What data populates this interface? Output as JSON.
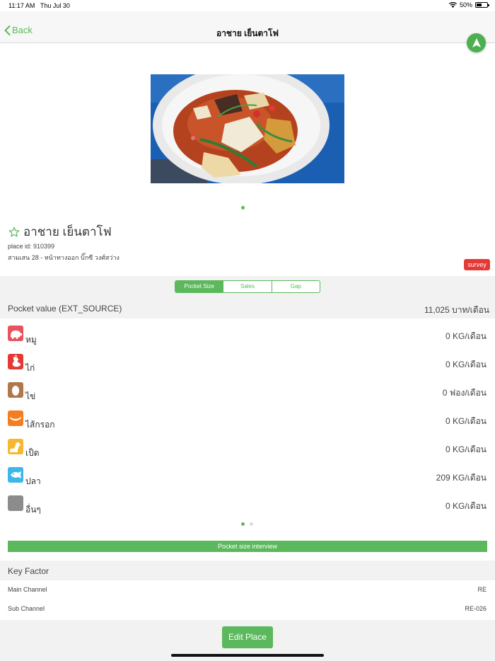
{
  "status": {
    "time": "11:17 AM",
    "date": "Thu Jul 30",
    "battery_text": "50%",
    "battery_level": 0.5
  },
  "nav": {
    "back_label": "Back",
    "title": "อาชาย เย็นตาโฟ"
  },
  "place": {
    "name": "อาชาย เย็นตาโฟ",
    "id_text": "place id: 910399",
    "address": "สามเสน 28 - หน้าทางออก บิ๊กซี วงศ์สว่าง",
    "survey_badge": "survey"
  },
  "tabs": [
    {
      "label": "Pocket Size",
      "active": true
    },
    {
      "label": "Sales",
      "active": false
    },
    {
      "label": "Gap",
      "active": false
    }
  ],
  "pocket": {
    "label": "Pocket value (EXT_SOURCE)",
    "value": "11,025 บาท/เดือน"
  },
  "categories": [
    {
      "label": "หมู",
      "value": "0 KG/เดือน",
      "icon": "pig-icon",
      "color": "#e8535d"
    },
    {
      "label": "ไก่",
      "value": "0 KG/เดือน",
      "icon": "chicken-icon",
      "color": "#e53935"
    },
    {
      "label": "ไข่",
      "value": "0 ฟอง/เดือน",
      "icon": "egg-icon",
      "color": "#b0784a"
    },
    {
      "label": "ไส้กรอก",
      "value": "0 KG/เดือน",
      "icon": "sausage-icon",
      "color": "#f57c1f"
    },
    {
      "label": "เป็ด",
      "value": "0 KG/เดือน",
      "icon": "duck-icon",
      "color": "#f5b82e"
    },
    {
      "label": "ปลา",
      "value": "209 KG/เดือน",
      "icon": "fish-icon",
      "color": "#3fb6e8"
    },
    {
      "label": "อื่นๆ",
      "value": "0 KG/เดือน",
      "icon": "other-icon",
      "color": "#8c8c8c"
    }
  ],
  "interview_button": "Pocket size interview",
  "key_factor": {
    "title": "Key Factor",
    "rows": [
      {
        "label": "Main Channel",
        "value": "RE"
      },
      {
        "label": "Sub Channel",
        "value": "RE-026"
      }
    ]
  },
  "edit_button": "Edit Place",
  "colors": {
    "accent": "#5cb85c",
    "badge": "#e53935"
  }
}
